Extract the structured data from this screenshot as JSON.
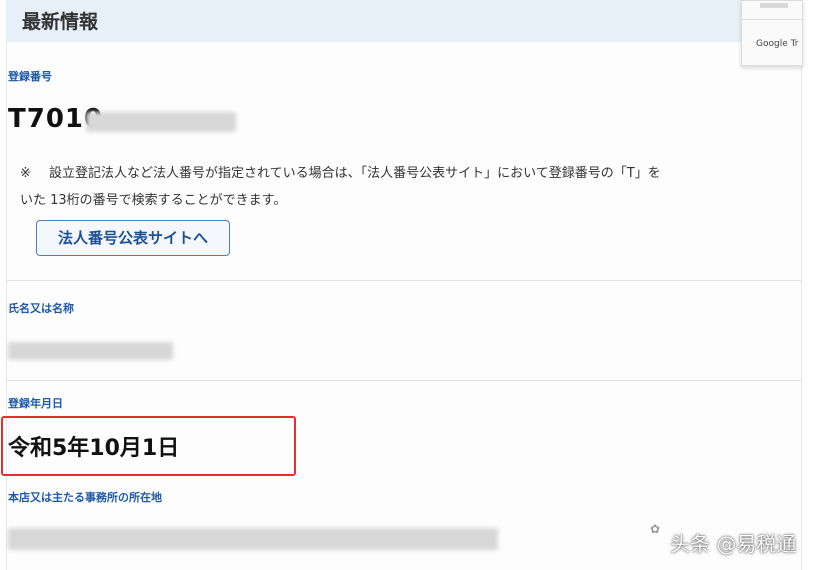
{
  "header": {
    "title": "最新情報"
  },
  "registration": {
    "label": "登録番号",
    "number_prefix": "T7010"
  },
  "note": {
    "mark": "※",
    "line1": "設立登記法人など法人番号が指定されている場合は、「法人番号公表サイト」において登録番号の「T」を",
    "line2": "いた 13桁の番号で検索することができます。"
  },
  "site_button": {
    "label": "法人番号公表サイトへ"
  },
  "name_section": {
    "label": "氏名又は名称"
  },
  "date_section": {
    "label": "登録年月日",
    "value": "令和5年10月1日"
  },
  "address_section": {
    "label": "本店又は主たる事務所の所在地"
  },
  "popup": {
    "label": "Google Tr"
  },
  "watermark": {
    "text": "头条 @易税通"
  },
  "colors": {
    "accent": "#1e5aa8",
    "highlight": "#e03030",
    "header_bg": "#e7f0f8"
  }
}
